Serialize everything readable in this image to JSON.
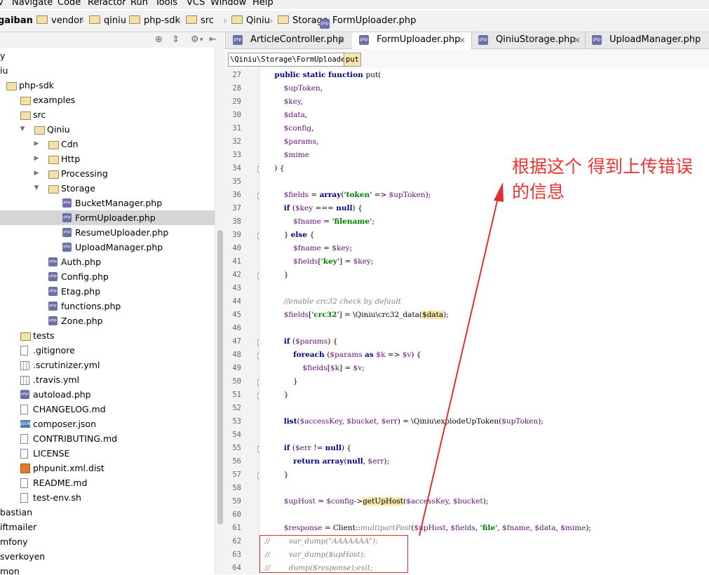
{
  "menu": [
    "v",
    "Navigate",
    "Code",
    "Refactor",
    "Run",
    "Tools",
    "VCS",
    "Window",
    "Help"
  ],
  "breadcrumb": [
    {
      "label": "gaiban",
      "bold": true,
      "icon": "none"
    },
    {
      "label": "vendor",
      "icon": "folder-icon"
    },
    {
      "label": "qiniu",
      "icon": "folder-icon"
    },
    {
      "label": "php-sdk",
      "icon": "folder-icon"
    },
    {
      "label": "src",
      "icon": "folder-icon"
    },
    {
      "label": "Qiniu",
      "icon": "folder-icon"
    },
    {
      "label": "Storage",
      "icon": "folder-icon"
    },
    {
      "label": "FormUploader.php",
      "icon": "php-file-icon"
    }
  ],
  "project_toolbar": {
    "icons": [
      "target-icon",
      "collapse-icon",
      "gear-icon",
      "hide-icon"
    ]
  },
  "tree": [
    {
      "label": "y",
      "type": "none",
      "indent": 0
    },
    {
      "label": "iu",
      "type": "none",
      "indent": 0
    },
    {
      "label": "php-sdk",
      "type": "folder",
      "indent": 0
    },
    {
      "label": "examples",
      "type": "folder",
      "indent": 1
    },
    {
      "label": "src",
      "type": "folder",
      "indent": 1
    },
    {
      "label": "Qiniu",
      "type": "folder",
      "indent": 2,
      "arrow": "down"
    },
    {
      "label": "Cdn",
      "type": "folder",
      "indent": 3,
      "arrow": "right"
    },
    {
      "label": "Http",
      "type": "folder",
      "indent": 3,
      "arrow": "right"
    },
    {
      "label": "Processing",
      "type": "folder",
      "indent": 3,
      "arrow": "right"
    },
    {
      "label": "Storage",
      "type": "folder",
      "indent": 3,
      "arrow": "down"
    },
    {
      "label": "BucketManager.php",
      "type": "php",
      "indent": 4
    },
    {
      "label": "FormUploader.php",
      "type": "php",
      "indent": 4,
      "selected": true
    },
    {
      "label": "ResumeUploader.php",
      "type": "php",
      "indent": 4
    },
    {
      "label": "UploadManager.php",
      "type": "php",
      "indent": 4
    },
    {
      "label": "Auth.php",
      "type": "php",
      "indent": 3
    },
    {
      "label": "Config.php",
      "type": "php",
      "indent": 3
    },
    {
      "label": "Etag.php",
      "type": "php",
      "indent": 3
    },
    {
      "label": "functions.php",
      "type": "php",
      "indent": 3
    },
    {
      "label": "Zone.php",
      "type": "php",
      "indent": 3
    },
    {
      "label": "tests",
      "type": "folder",
      "indent": 1
    },
    {
      "label": ".gitignore",
      "type": "file",
      "indent": 1
    },
    {
      "label": ".scrutinizer.yml",
      "type": "yml",
      "indent": 1
    },
    {
      "label": ".travis.yml",
      "type": "yml",
      "indent": 1
    },
    {
      "label": "autoload.php",
      "type": "php",
      "indent": 1
    },
    {
      "label": "CHANGELOG.md",
      "type": "file",
      "indent": 1
    },
    {
      "label": "composer.json",
      "type": "json",
      "indent": 1
    },
    {
      "label": "CONTRIBUTING.md",
      "type": "file",
      "indent": 1
    },
    {
      "label": "LICENSE",
      "type": "file",
      "indent": 1
    },
    {
      "label": "phpunit.xml.dist",
      "type": "xml",
      "indent": 1
    },
    {
      "label": "README.md",
      "type": "file",
      "indent": 1
    },
    {
      "label": "test-env.sh",
      "type": "file",
      "indent": 1
    },
    {
      "label": "bastian",
      "type": "none",
      "indent": 0
    },
    {
      "label": "iftmailer",
      "type": "none",
      "indent": 0
    },
    {
      "label": "mfony",
      "type": "none",
      "indent": 0
    },
    {
      "label": "sverkoyen",
      "type": "none",
      "indent": 0
    },
    {
      "label": "mon",
      "type": "none",
      "indent": 0
    }
  ],
  "tabs": [
    {
      "label": "ArticleController.php",
      "active": false
    },
    {
      "label": "FormUploader.php",
      "active": true
    },
    {
      "label": "QiniuStorage.php",
      "active": false
    },
    {
      "label": "UploadManager.php",
      "active": false
    }
  ],
  "tab_close_glyph": "×",
  "editor_breadcrumb": [
    "\\Qiniu\\Storage\\FormUploader",
    "put"
  ],
  "code": [
    {
      "n": "27",
      "t": [
        [
          "",
          "    "
        ],
        [
          "kw",
          "public static function "
        ],
        [
          "",
          "put("
        ]
      ]
    },
    {
      "n": "28",
      "t": [
        [
          "",
          "        "
        ],
        [
          "var",
          "$upToken"
        ],
        [
          "",
          ","
        ]
      ]
    },
    {
      "n": "29",
      "t": [
        [
          "",
          "        "
        ],
        [
          "var",
          "$key"
        ],
        [
          "",
          ","
        ]
      ]
    },
    {
      "n": "30",
      "t": [
        [
          "",
          "        "
        ],
        [
          "var",
          "$data"
        ],
        [
          "",
          ","
        ]
      ]
    },
    {
      "n": "31",
      "t": [
        [
          "",
          "        "
        ],
        [
          "var",
          "$config"
        ],
        [
          "",
          ","
        ]
      ]
    },
    {
      "n": "32",
      "t": [
        [
          "",
          "        "
        ],
        [
          "var",
          "$params"
        ],
        [
          "",
          ","
        ]
      ]
    },
    {
      "n": "33",
      "t": [
        [
          "",
          "        "
        ],
        [
          "var",
          "$mime"
        ]
      ]
    },
    {
      "n": "34",
      "t": [
        [
          "",
          "    ) {"
        ]
      ]
    },
    {
      "n": "35",
      "t": []
    },
    {
      "n": "36",
      "t": [
        [
          "",
          "        "
        ],
        [
          "var",
          "$fields"
        ],
        [
          "",
          " = "
        ],
        [
          "kw",
          "array"
        ],
        [
          "",
          "("
        ],
        [
          "str",
          "'token'"
        ],
        [
          "",
          " => "
        ],
        [
          "var",
          "$upToken"
        ],
        [
          "",
          ");"
        ]
      ]
    },
    {
      "n": "37",
      "t": [
        [
          "",
          "        "
        ],
        [
          "kw",
          "if "
        ],
        [
          "",
          "("
        ],
        [
          "var",
          "$key"
        ],
        [
          "",
          " === "
        ],
        [
          "kw",
          "null"
        ],
        [
          "",
          ") {"
        ]
      ]
    },
    {
      "n": "38",
      "t": [
        [
          "",
          "            "
        ],
        [
          "var",
          "$fname"
        ],
        [
          "",
          " = "
        ],
        [
          "str",
          "'filename'"
        ],
        [
          "",
          ";"
        ]
      ]
    },
    {
      "n": "39",
      "t": [
        [
          "",
          "        } "
        ],
        [
          "kw",
          "else "
        ],
        [
          "",
          "{"
        ]
      ]
    },
    {
      "n": "40",
      "t": [
        [
          "",
          "            "
        ],
        [
          "var",
          "$fname"
        ],
        [
          "",
          " = "
        ],
        [
          "var",
          "$key"
        ],
        [
          "",
          ";"
        ]
      ]
    },
    {
      "n": "41",
      "t": [
        [
          "",
          "            "
        ],
        [
          "var",
          "$fields"
        ],
        [
          "",
          "["
        ],
        [
          "str",
          "'key'"
        ],
        [
          "",
          "] = "
        ],
        [
          "var",
          "$key"
        ],
        [
          "",
          ";"
        ]
      ]
    },
    {
      "n": "42",
      "t": [
        [
          "",
          "        }"
        ]
      ]
    },
    {
      "n": "43",
      "t": []
    },
    {
      "n": "44",
      "t": [
        [
          "",
          "        "
        ],
        [
          "cmt",
          "//enable crc32 check by default"
        ]
      ]
    },
    {
      "n": "45",
      "t": [
        [
          "",
          "        "
        ],
        [
          "var",
          "$fields"
        ],
        [
          "",
          "["
        ],
        [
          "str",
          "'crc32'"
        ],
        [
          "",
          "] = \\Qiniu\\crc32_data("
        ],
        [
          "hl-yellow",
          "$data"
        ],
        [
          "",
          ");"
        ]
      ]
    },
    {
      "n": "46",
      "t": []
    },
    {
      "n": "47",
      "t": [
        [
          "",
          "        "
        ],
        [
          "kw",
          "if "
        ],
        [
          "",
          "("
        ],
        [
          "var",
          "$params"
        ],
        [
          "",
          ") {"
        ]
      ]
    },
    {
      "n": "48",
      "t": [
        [
          "",
          "            "
        ],
        [
          "kw",
          "foreach "
        ],
        [
          "",
          "("
        ],
        [
          "var",
          "$params"
        ],
        [
          "",
          " "
        ],
        [
          "kw",
          "as "
        ],
        [
          "var",
          "$k"
        ],
        [
          "",
          " => "
        ],
        [
          "var",
          "$v"
        ],
        [
          "",
          ") {"
        ]
      ]
    },
    {
      "n": "49",
      "t": [
        [
          "",
          "                "
        ],
        [
          "var",
          "$fields"
        ],
        [
          "",
          "["
        ],
        [
          "var",
          "$k"
        ],
        [
          "",
          "] = "
        ],
        [
          "var",
          "$v"
        ],
        [
          "",
          ";"
        ]
      ]
    },
    {
      "n": "50",
      "t": [
        [
          "",
          "            }"
        ]
      ]
    },
    {
      "n": "51",
      "t": [
        [
          "",
          "        }"
        ]
      ]
    },
    {
      "n": "52",
      "t": []
    },
    {
      "n": "53",
      "t": [
        [
          "",
          "        "
        ],
        [
          "kw",
          "list"
        ],
        [
          "",
          "("
        ],
        [
          "var",
          "$accessKey"
        ],
        [
          "",
          ", "
        ],
        [
          "var",
          "$bucket"
        ],
        [
          "",
          ", "
        ],
        [
          "var",
          "$err"
        ],
        [
          "",
          ") = \\Qiniu\\explodeUpToken("
        ],
        [
          "var",
          "$upToken"
        ],
        [
          "",
          ");"
        ]
      ]
    },
    {
      "n": "54",
      "t": []
    },
    {
      "n": "55",
      "t": [
        [
          "",
          "        "
        ],
        [
          "kw",
          "if "
        ],
        [
          "",
          "("
        ],
        [
          "var",
          "$err"
        ],
        [
          "",
          " != "
        ],
        [
          "kw",
          "null"
        ],
        [
          "",
          ") {"
        ]
      ]
    },
    {
      "n": "56",
      "t": [
        [
          "",
          "            "
        ],
        [
          "kw",
          "return array"
        ],
        [
          "",
          "("
        ],
        [
          "kw",
          "null"
        ],
        [
          "",
          ", "
        ],
        [
          "var",
          "$err"
        ],
        [
          "",
          ");"
        ]
      ]
    },
    {
      "n": "57",
      "t": [
        [
          "",
          "        }"
        ]
      ]
    },
    {
      "n": "58",
      "t": []
    },
    {
      "n": "59",
      "t": [
        [
          "",
          "        "
        ],
        [
          "var",
          "$upHost"
        ],
        [
          "",
          " = "
        ],
        [
          "var",
          "$config"
        ],
        [
          "",
          "->"
        ],
        [
          "hl-yellow",
          "getUpHost"
        ],
        [
          "",
          "("
        ],
        [
          "var",
          "$accessKey"
        ],
        [
          "",
          ", "
        ],
        [
          "var",
          "$bucket"
        ],
        [
          "",
          ");"
        ]
      ]
    },
    {
      "n": "60",
      "t": []
    },
    {
      "n": "61",
      "t": [
        [
          "",
          "        "
        ],
        [
          "var",
          "$response"
        ],
        [
          "",
          " = Client::"
        ],
        [
          "cmt",
          "multipartPost"
        ],
        [
          "",
          "("
        ],
        [
          "var",
          "$upHost"
        ],
        [
          "",
          ", "
        ],
        [
          "var",
          "$fields"
        ],
        [
          "",
          ", "
        ],
        [
          "str",
          "'file'"
        ],
        [
          "",
          ", "
        ],
        [
          "var",
          "$fname"
        ],
        [
          "",
          ", "
        ],
        [
          "var",
          "$data"
        ],
        [
          "",
          ", "
        ],
        [
          "var",
          "$mime"
        ],
        [
          "",
          ");"
        ]
      ]
    },
    {
      "n": "62",
      "t": [
        [
          "cmt",
          "//        var_dump(\"AAAAAAA\");"
        ]
      ]
    },
    {
      "n": "63",
      "t": [
        [
          "cmt",
          "//        var_dump($upHost);"
        ]
      ]
    },
    {
      "n": "64",
      "t": [
        [
          "cmt",
          "//        dump($response);exit;"
        ]
      ]
    }
  ],
  "fold_lines": [
    "34",
    "36",
    "39",
    "42",
    "47",
    "48",
    "50",
    "51",
    "55",
    "57"
  ],
  "annotation": {
    "text": "根据这个 得到上传错误的信息",
    "color": "#ee3333"
  }
}
